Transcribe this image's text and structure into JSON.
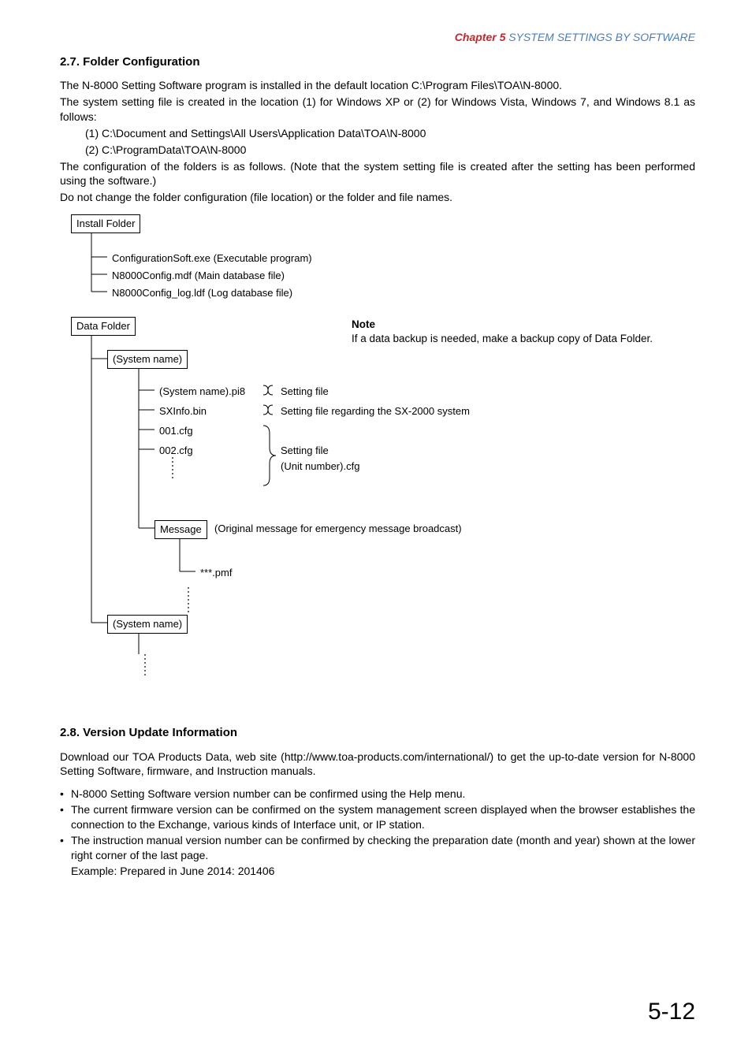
{
  "header": {
    "chapter_label": "Chapter 5",
    "chapter_title": "  SYSTEM SETTINGS BY SOFTWARE"
  },
  "section1": {
    "heading": "2.7. Folder Configuration",
    "p1": "The N-8000 Setting Software program is installed in the default location C:\\Program Files\\TOA\\N-8000.",
    "p2": "The system setting file is created in the location (1) for Windows XP or (2) for Windows Vista, Windows 7, and Windows 8.1 as follows:",
    "loc1": "(1) C:\\Document and Settings\\All Users\\Application Data\\TOA\\N-8000",
    "loc2": "(2) C:\\ProgramData\\TOA\\N-8000",
    "p3": "The configuration of the folders is as follows. (Note that the system setting file is created after the setting has been performed using the software.)",
    "p4": "Do not change the folder configuration (file location) or the folder and file names."
  },
  "tree": {
    "install_box": "Install Folder",
    "i1": "ConfigurationSoft.exe (Executable program)",
    "i2": "N8000Config.mdf (Main database file)",
    "i3": "N8000Config_log.ldf (Log database file)",
    "data_box": "Data Folder",
    "note_title": "Note",
    "note_body": "If a data backup is needed, make a backup copy of Data Folder.",
    "sysname_box": "(System name)",
    "d1": "(System name).pi8",
    "d1_r": "Setting file",
    "d2": "SXInfo.bin",
    "d2_r": "Setting file regarding the SX-2000 system",
    "d3": "001.cfg",
    "d4": "002.cfg",
    "d4_r1": "Setting file",
    "d4_r2": "(Unit number).cfg",
    "msg_box": "Message",
    "msg_r": "(Original message for emergency message broadcast)",
    "m1": "***.pmf",
    "sysname_box2": "(System name)"
  },
  "section2": {
    "heading": "2.8. Version Update Information",
    "p1": "Download our TOA Products Data, web site (http://www.toa-products.com/international/) to get the up-to-date version for N-8000 Setting Software, firmware, and Instruction manuals.",
    "b1": "N-8000 Setting Software version number can be confirmed using the Help menu.",
    "b2": "The current firmware version can be confirmed on the system management screen displayed when the browser establishes the connection to the Exchange, various kinds of Interface unit, or IP station.",
    "b3": "The instruction manual version number can be confirmed by checking the preparation date (month and year) shown at the lower right corner of the last page.",
    "b3_sub": "Example: Prepared in June 2014: 201406"
  },
  "page_number": "5-12"
}
